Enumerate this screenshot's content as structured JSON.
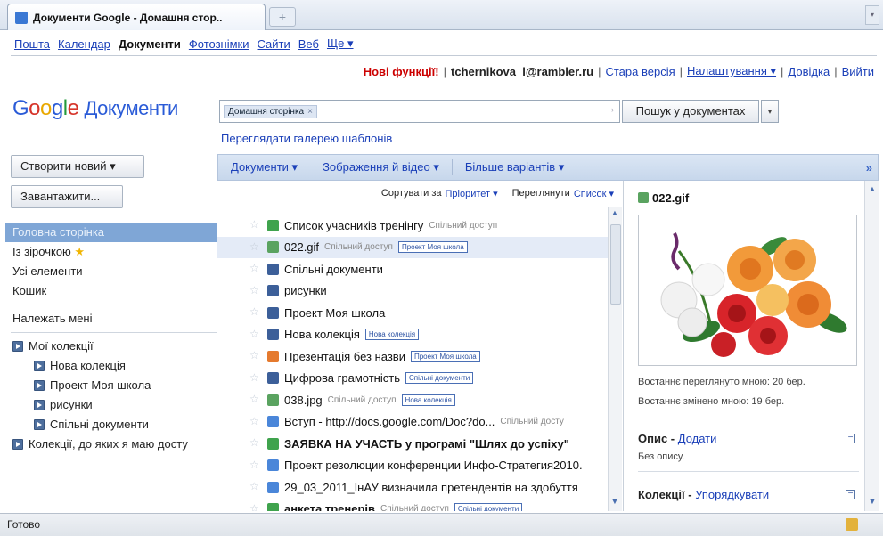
{
  "browser": {
    "tab_title": "Документи Google - Домашня стор..",
    "new_tab": "+"
  },
  "topnav": {
    "items": [
      "Пошта",
      "Календар",
      "Документи",
      "Фотознімки",
      "Сайти",
      "Веб",
      "Ще ▾"
    ]
  },
  "userbar": {
    "new_features": "Нові функції!",
    "email": "tchernikova_l@rambler.ru",
    "old_version": "Стара версія",
    "settings": "Налаштування ▾",
    "help": "Довідка",
    "logout": "Вийти"
  },
  "logo": {
    "product": "Документи"
  },
  "search": {
    "chip": "Домашня сторінка",
    "button": "Пошук у документах",
    "gallery_link": "Переглядати галерею шаблонів"
  },
  "left": {
    "create": "Створити новий ▾",
    "upload": "Завантажити...",
    "nav": [
      "Головна сторінка",
      "Із зірочкою",
      "Усі елементи",
      "Кошик"
    ],
    "mine": "Належать мені",
    "my_collections": "Мої колекції",
    "collections": [
      "Нова колекція",
      "Проект Моя школа",
      "рисунки",
      "Спільні документи"
    ],
    "shared_collections": "Колекції, до яких я маю досту"
  },
  "toolbar": {
    "docs": "Документи ▾",
    "media": "Зображення й відео ▾",
    "more": "Більше варіантів ▾",
    "expand": "»"
  },
  "sort": {
    "sort_label": "Сортувати за",
    "sort_value": "Пріоритет ▾",
    "view_label": "Переглянути",
    "view_value": "Список ▾"
  },
  "rows": [
    {
      "title": "Список учасників тренінгу",
      "share": "Спільний доступ",
      "tag": "",
      "color": "#3fa34d",
      "bold": false
    },
    {
      "title": "022.gif",
      "share": "Спільний доступ",
      "tag": "Проект Моя школа",
      "color": "#5aa360",
      "bold": false
    },
    {
      "title": "Спільні документи",
      "share": "",
      "tag": "",
      "color": "#3c5f99",
      "bold": false
    },
    {
      "title": "рисунки",
      "share": "",
      "tag": "",
      "color": "#3c5f99",
      "bold": false
    },
    {
      "title": "Проект Моя школа",
      "share": "",
      "tag": "",
      "color": "#3c5f99",
      "bold": false
    },
    {
      "title": "Нова колекція",
      "share": "",
      "tag": "Нова колекція",
      "color": "#3c5f99",
      "bold": false
    },
    {
      "title": "Презентація без назви",
      "share": "",
      "tag": "Проект Моя школа",
      "color": "#e57a2e",
      "bold": false
    },
    {
      "title": "Цифрова грамотність",
      "share": "",
      "tag": "Спільні документи",
      "color": "#3c5f99",
      "bold": false
    },
    {
      "title": "038.jpg",
      "share": "Спільний доступ",
      "tag": "Нова колекція",
      "color": "#5aa360",
      "bold": false
    },
    {
      "title": "Вступ - http://docs.google.com/Doc?do...",
      "share": "Спільний досту",
      "tag": "",
      "color": "#4a86d9",
      "bold": false
    },
    {
      "title": "ЗАЯВКА НА УЧАСТЬ у програмі \"Шлях до успіху\"",
      "share": "",
      "tag": "",
      "color": "#3fa34d",
      "bold": true
    },
    {
      "title": "Проект резолюции конференции Инфо-Стратегия2010.",
      "share": "",
      "tag": "",
      "color": "#4a86d9",
      "bold": false
    },
    {
      "title": "29_03_2011_ІнАУ визначила претендентів на здобуття",
      "share": "",
      "tag": "",
      "color": "#4a86d9",
      "bold": false
    },
    {
      "title": "анкета тренерів",
      "share": "Спільний доступ",
      "tag": "Спільні документи",
      "color": "#3fa34d",
      "bold": true
    }
  ],
  "preview": {
    "title": "022.gif",
    "viewed": "Востаннє переглянуто мною: 20 бер.",
    "modified": "Востаннє змінено мною: 19 бер.",
    "desc_label": "Опис",
    "desc_add": "Додати",
    "desc_text": "Без опису.",
    "coll_label": "Колекції",
    "coll_link": "Упорядкувати"
  },
  "status": {
    "text": "Готово"
  }
}
